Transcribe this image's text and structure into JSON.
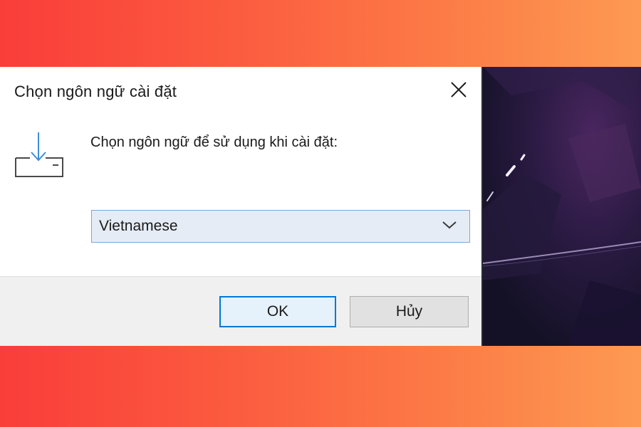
{
  "dialog": {
    "title": "Chọn ngôn ngữ cài đặt",
    "prompt": "Chọn ngôn ngữ để sử dụng khi cài đặt:",
    "language_select": {
      "value": "Vietnamese"
    },
    "buttons": {
      "ok_label": "OK",
      "cancel_label": "Hủy"
    }
  },
  "icons": {
    "close": "close-icon",
    "install": "install-download-icon",
    "dropdown": "chevron-down-icon"
  },
  "colors": {
    "accent": "#0078d7",
    "select_background": "#e6ecf6",
    "gradient_start": "#fa3d3a",
    "gradient_end": "#fd9a52"
  }
}
